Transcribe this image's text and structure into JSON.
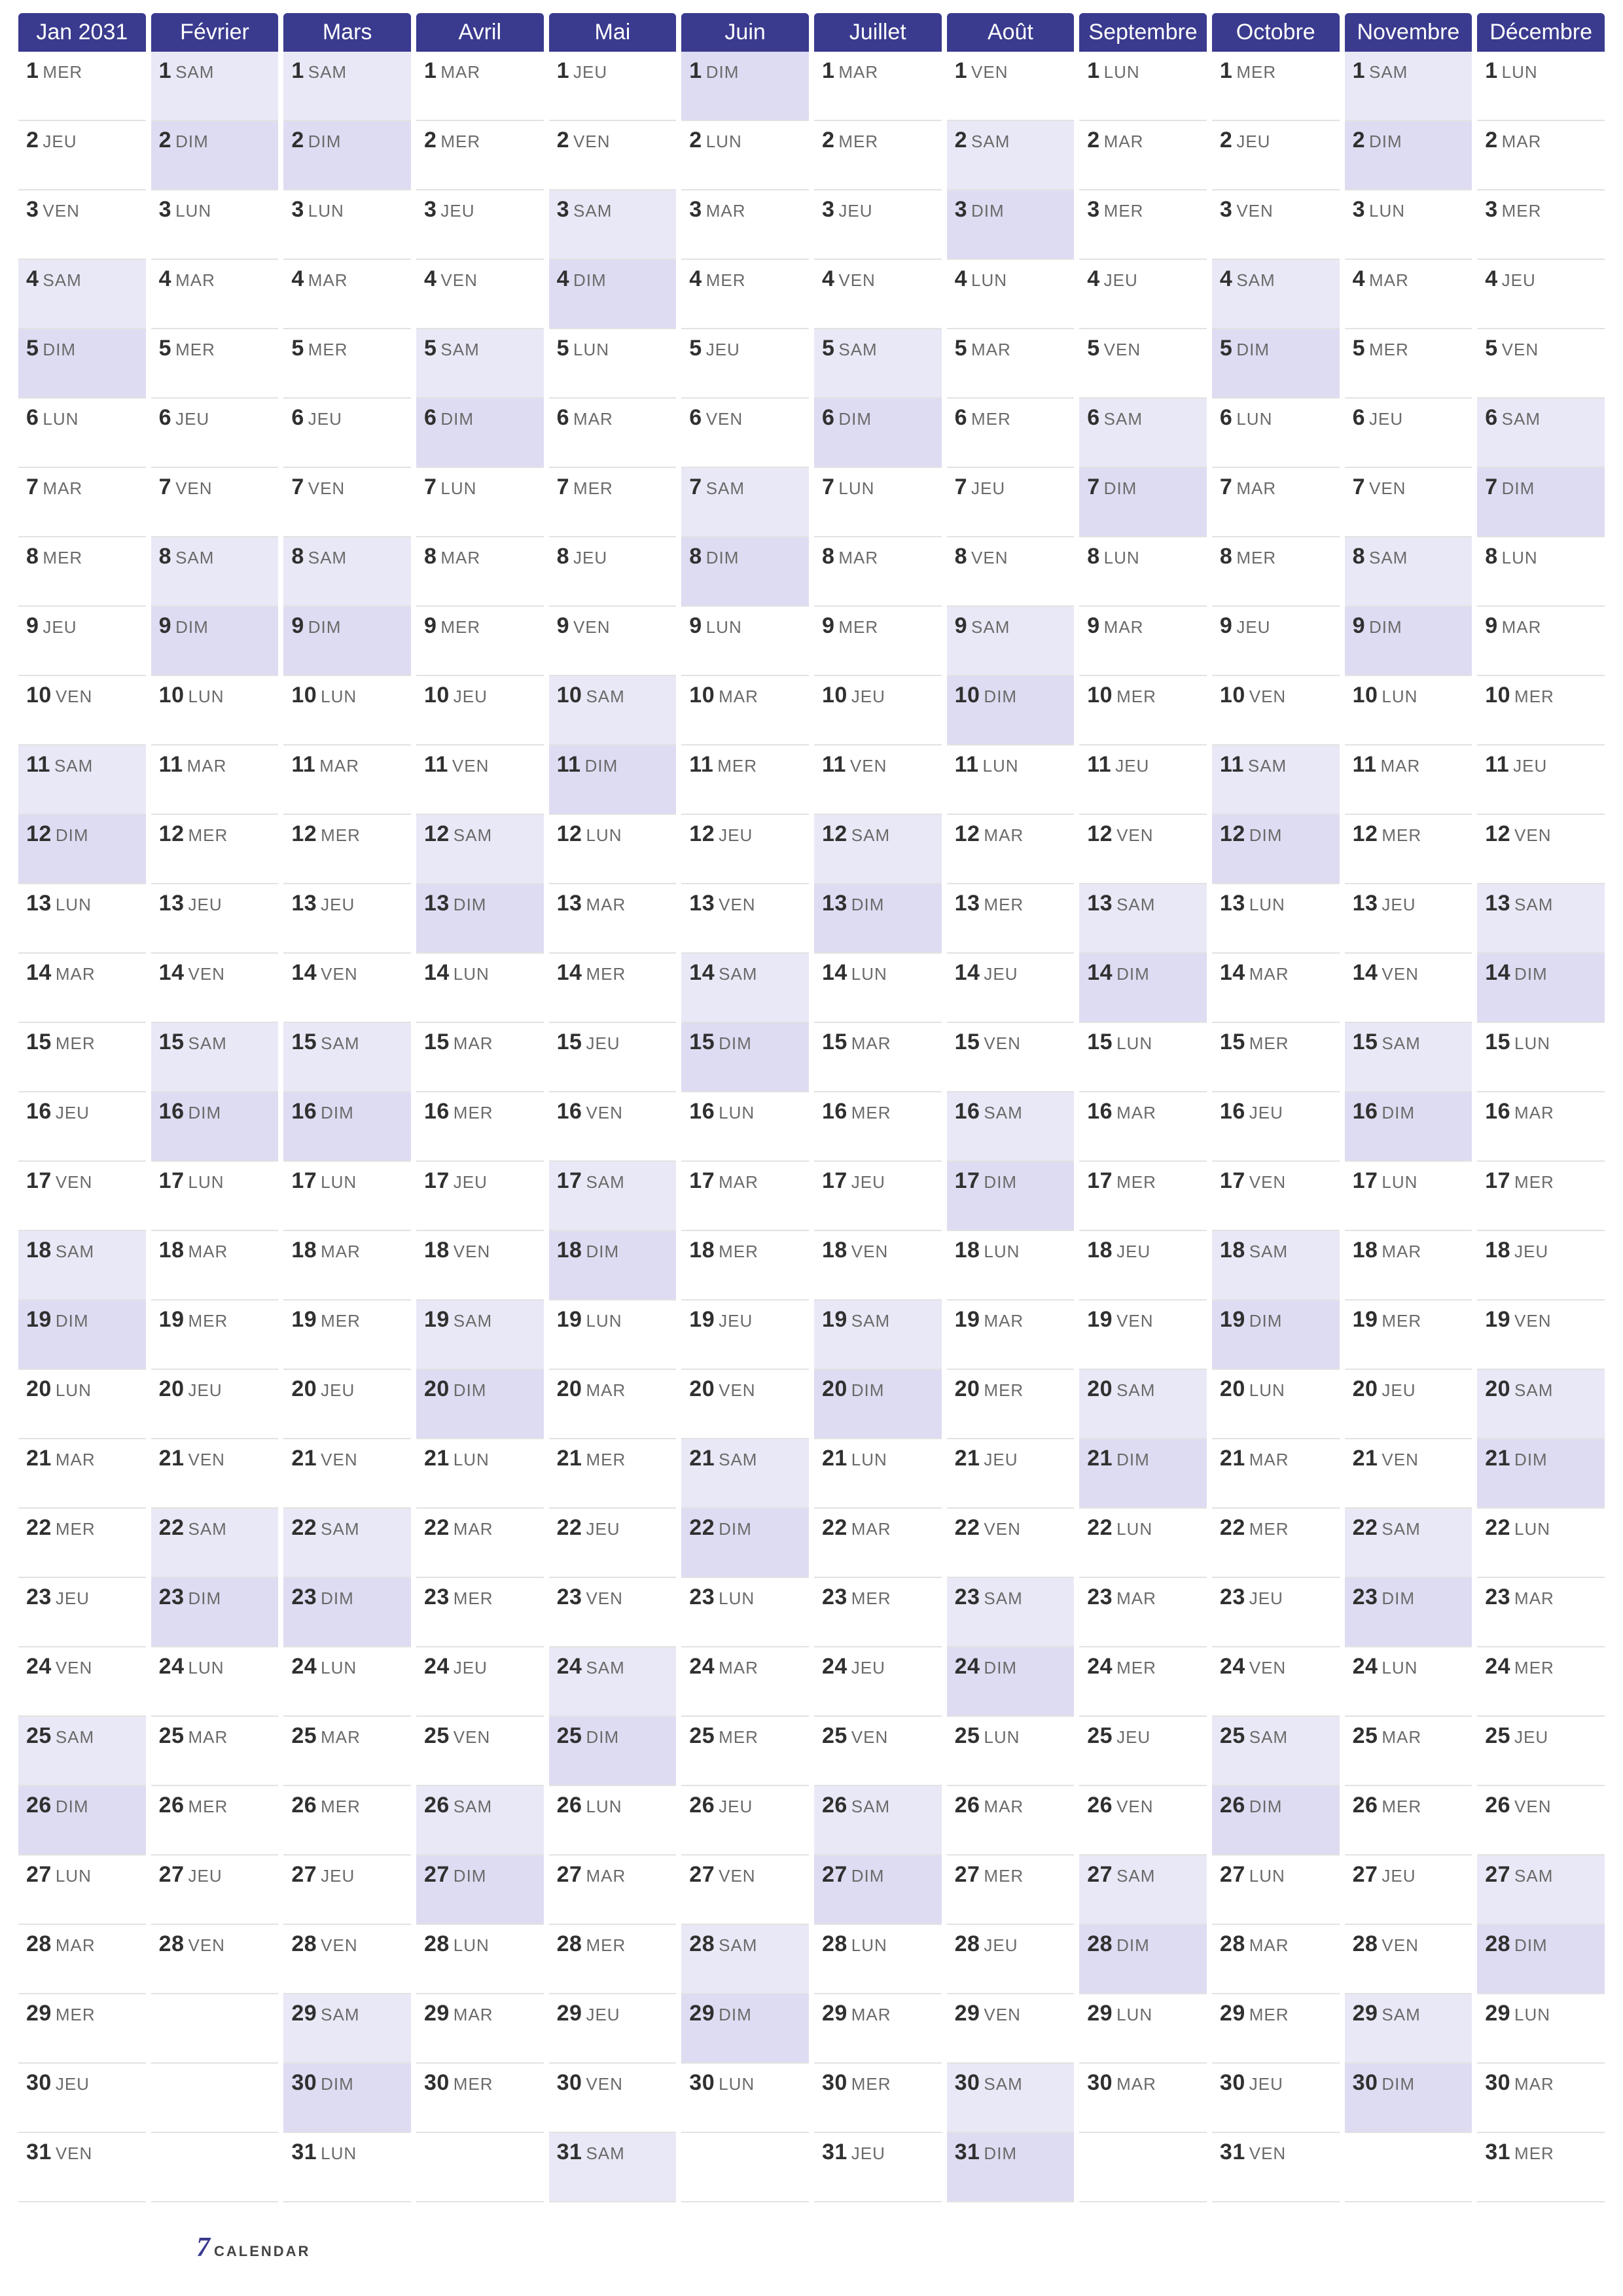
{
  "year": 2031,
  "brand": {
    "digit": "7",
    "text": "CALENDAR"
  },
  "dayAbbrs": [
    "LUN",
    "MAR",
    "MER",
    "JEU",
    "VEN",
    "SAM",
    "DIM"
  ],
  "months": [
    {
      "name": "Jan 2031",
      "days": 31,
      "startDow": 3
    },
    {
      "name": "Février",
      "days": 28,
      "startDow": 6
    },
    {
      "name": "Mars",
      "days": 31,
      "startDow": 6
    },
    {
      "name": "Avril",
      "days": 30,
      "startDow": 2
    },
    {
      "name": "Mai",
      "days": 31,
      "startDow": 4
    },
    {
      "name": "Juin",
      "days": 30,
      "startDow": 7
    },
    {
      "name": "Juillet",
      "days": 31,
      "startDow": 2
    },
    {
      "name": "Août",
      "days": 31,
      "startDow": 5
    },
    {
      "name": "Septembre",
      "days": 30,
      "startDow": 1
    },
    {
      "name": "Octobre",
      "days": 31,
      "startDow": 3
    },
    {
      "name": "Novembre",
      "days": 30,
      "startDow": 6
    },
    {
      "name": "Décembre",
      "days": 31,
      "startDow": 1
    }
  ]
}
